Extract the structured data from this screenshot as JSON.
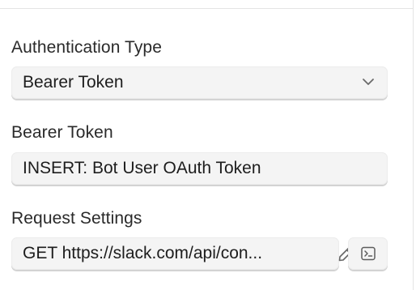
{
  "auth": {
    "type_label": "Authentication Type",
    "type_value": "Bearer Token"
  },
  "token": {
    "label": "Bearer Token",
    "value": "INSERT: Bot User OAuth Token"
  },
  "request": {
    "label": "Request Settings",
    "value": "GET https://slack.com/api/con..."
  },
  "icons": {
    "select_chevron": "chevron-down-icon",
    "edit": "pencil-icon",
    "terminal": "terminal-icon"
  }
}
